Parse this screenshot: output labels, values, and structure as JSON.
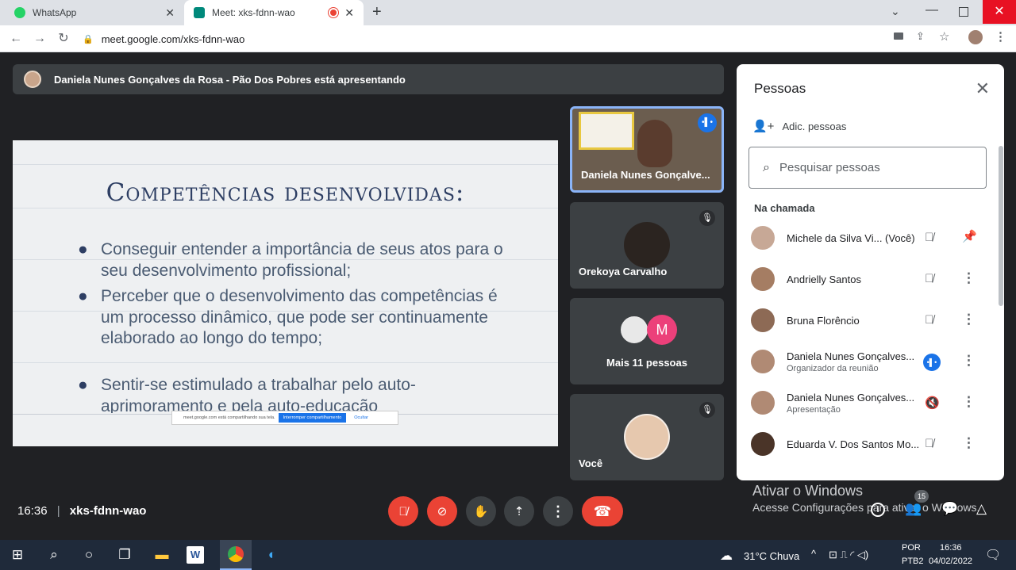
{
  "browser": {
    "tabs": [
      {
        "label": "WhatsApp",
        "icon": "whatsapp-icon",
        "color": "#25d366"
      },
      {
        "label": "Meet: xks-fdnn-wao",
        "icon": "meet-icon",
        "color": "#00897b",
        "recording": true
      }
    ],
    "url": "meet.google.com/xks-fdnn-wao"
  },
  "presenter_banner": "Daniela Nunes Gonçalves da Rosa - Pão Dos Pobres está apresentando",
  "slide": {
    "title": "Competências desenvolvidas:",
    "bullets": [
      "Conseguir entender a importância de seus atos para o seu desenvolvimento profissional;",
      "Perceber que o desenvolvimento das competências é um processo dinâmico, que pode ser continuamente elaborado ao longo do tempo;",
      "Sentir-se estimulado a trabalhar pelo auto-aprimoramento e pela auto-educação"
    ],
    "sharebar": {
      "message": "meet.google.com está compartilhando sua tela.",
      "stop_label": "Interromper compartilhamento",
      "hide_label": "Ocultar"
    }
  },
  "tiles": [
    {
      "name": "Daniela Nunes Gonçalve...",
      "speaking": true
    },
    {
      "name": "Orekoya Carvalho",
      "muted": true
    },
    {
      "name": "Mais 11 pessoas",
      "avatar_letter": "M"
    },
    {
      "name": "Você",
      "muted": true
    }
  ],
  "people_panel": {
    "title": "Pessoas",
    "add_label": "Adic. pessoas",
    "search_placeholder": "Pesquisar pessoas",
    "section_label": "Na chamada",
    "people": [
      {
        "name": "Michele da Silva Vi...  (Você)",
        "sub": "",
        "mic": "muted",
        "action": "pin"
      },
      {
        "name": "Andrielly Santos",
        "sub": "",
        "mic": "muted",
        "action": "more"
      },
      {
        "name": "Bruna Florêncio",
        "sub": "",
        "mic": "muted",
        "action": "more"
      },
      {
        "name": "Daniela Nunes Gonçalves...",
        "sub": "Organizador da reunião",
        "mic": "speaking",
        "action": "more"
      },
      {
        "name": "Daniela Nunes Gonçalves...",
        "sub": "Apresentação",
        "mic": "audio-off",
        "action": "more"
      },
      {
        "name": "Eduarda V. Dos Santos Mo...",
        "sub": "",
        "mic": "muted",
        "action": "more"
      }
    ]
  },
  "meeting": {
    "time": "16:36",
    "code": "xks-fdnn-wao",
    "participants_badge": "15"
  },
  "watermark": {
    "line1": "Ativar o Windows",
    "line2": "Acesse Configurações para ativar o Windows."
  },
  "taskbar": {
    "weather": "31°C  Chuva",
    "lang": "POR",
    "lang2": "PTB2",
    "time": "16:36",
    "date": "04/02/2022"
  },
  "colors": {
    "meet_red": "#ea4335",
    "accent_blue": "#1a73e8",
    "panel_bg": "#ffffff",
    "stage_bg": "#202124"
  }
}
